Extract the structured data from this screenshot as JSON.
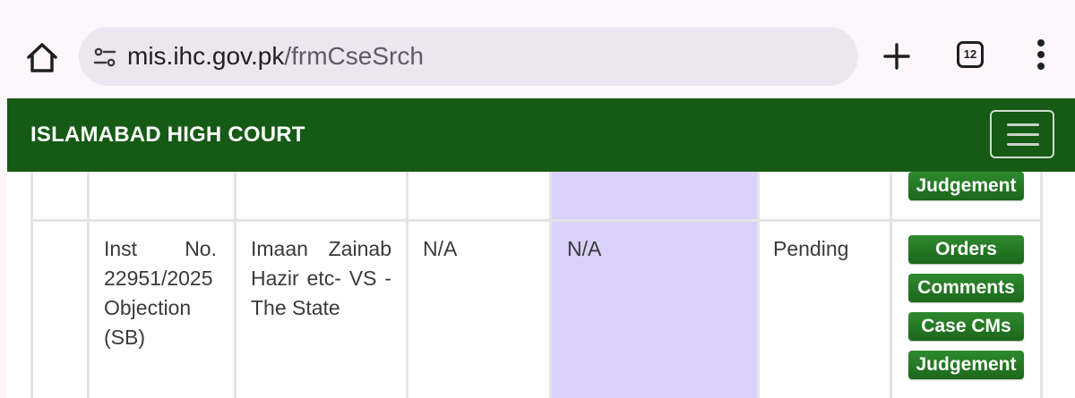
{
  "browser": {
    "url_host": "mis.ihc.gov.pk",
    "url_path": "/frmCseSrch",
    "tab_count": "12",
    "icons": [
      "home-icon",
      "site-settings-icon",
      "plus-icon",
      "tab-switcher-icon",
      "more-vert-icon"
    ]
  },
  "header": {
    "title": "ISLAMABAD HIGH COURT",
    "brand_color": "#155a15"
  },
  "table": {
    "prev_row": {
      "actions": [
        "Judgement"
      ]
    },
    "row": {
      "case_no": "Inst No. 22951/2025 Objection (SB)",
      "title": "Imaan Zainab Hazir etc- VS - The State",
      "col3": "N/A",
      "col4": "N/A",
      "status": "Pending",
      "actions": [
        "Orders",
        "Comments",
        "Case CMs",
        "Judgement"
      ]
    },
    "highlight_color": "#d9d0fb"
  }
}
